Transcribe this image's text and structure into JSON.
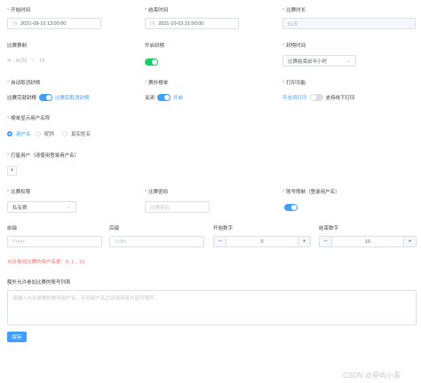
{
  "row1": {
    "start_time": {
      "label": "开始时间",
      "value": "2021-09-15 13:00:00"
    },
    "end_time": {
      "label": "结束时间",
      "value": "2021-10-03 21:00:00"
    },
    "duration": {
      "label": "比赛时长",
      "value": "51天"
    }
  },
  "row2": {
    "contest_type": {
      "label": "比赛赛制",
      "options": [
        "ACM",
        "OI"
      ],
      "selected": "ACM"
    },
    "open_board": {
      "label": "开启封榜",
      "on": true
    },
    "board_time": {
      "label": "封榜时间",
      "value": "比赛结束前半小时"
    }
  },
  "row3": {
    "auto_release": {
      "label": "自动取消封榜",
      "left": "比赛完就封榜",
      "right": "比赛后取消封榜",
      "on": true
    },
    "rank_list": {
      "label": "赛外榜单",
      "off_label": "关闭",
      "on_label": "开启",
      "on": true
    },
    "print": {
      "label": "打印功能",
      "left": "不支持打印",
      "right": "支持线下打印",
      "on": false
    }
  },
  "display_name": {
    "label": "榜单显示用户名称",
    "options": [
      "用户名",
      "昵称",
      "真实姓名"
    ],
    "selected": "用户名"
  },
  "star_users": {
    "label": "打星用户（请使用登录用户名）",
    "add": "+"
  },
  "row4": {
    "auth": {
      "label": "比赛权限",
      "value": "私有赛"
    },
    "password": {
      "label": "比赛密码",
      "placeholder": "比赛密码"
    },
    "account_limit": {
      "label": "账号限制（登录用户名）",
      "on": true
    }
  },
  "row5": {
    "prefix": {
      "label": "前缀",
      "placeholder": "Prefix"
    },
    "suffix": {
      "label": "后缀",
      "placeholder": "Suffix"
    },
    "start_num": {
      "label": "开始数字",
      "value": "0",
      "minus": "−",
      "plus": "+"
    },
    "end_num": {
      "label": "结束数字",
      "value": "10",
      "minus": "−",
      "plus": "+"
    }
  },
  "allowed_hint": "允许参加比赛的用户名是：0, 1... 10",
  "extra_accounts": {
    "label": "额外允许参加比赛的账号列表",
    "placeholder": "请输入允许参赛的账号用户名，不同用户名之间请用英文逗号隔开。"
  },
  "save_label": "保存",
  "watermark": "CSDN @星屿小青"
}
